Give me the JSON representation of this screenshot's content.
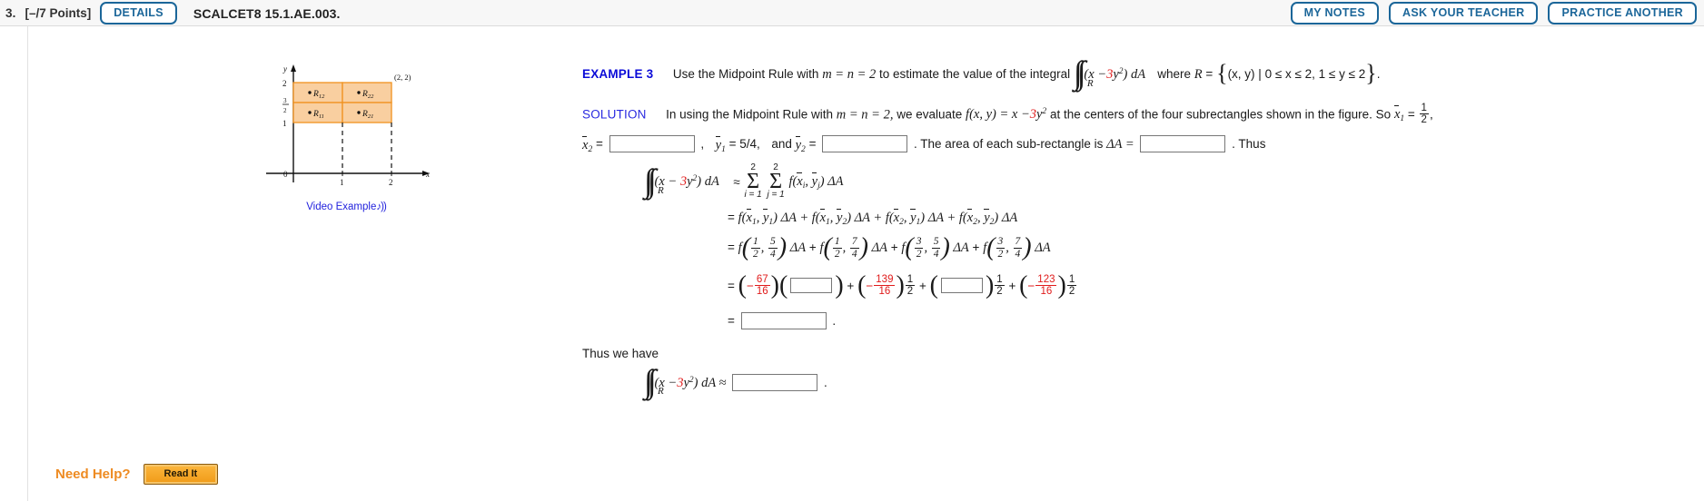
{
  "topbar": {
    "question_number": "3.",
    "points": "[–/7 Points]",
    "details_button": "DETAILS",
    "question_code": "SCALCET8 15.1.AE.003.",
    "my_notes_button": "MY NOTES",
    "ask_teacher_button": "ASK YOUR TEACHER",
    "practice_another_button": "PRACTICE ANOTHER"
  },
  "figure": {
    "axis_y_label": "y",
    "axis_x_label": "x",
    "origin_label": "0",
    "x_ticks": [
      "1",
      "2"
    ],
    "y_ticks": [
      "2",
      "1"
    ],
    "y_frac_tick_num": "3",
    "y_frac_tick_den": "2",
    "corner_label": "(2, 2)",
    "cells": [
      "R12",
      "R22",
      "R11",
      "R21"
    ],
    "cell_labels": [
      {
        "base": "R",
        "sub": "12"
      },
      {
        "base": "R",
        "sub": "22"
      },
      {
        "base": "R",
        "sub": "11"
      },
      {
        "base": "R",
        "sub": "21"
      }
    ],
    "fill_color": "#f9cfa0",
    "stroke_color": "#f0921e",
    "video_example_link": "Video Example"
  },
  "example": {
    "label": "EXAMPLE 3",
    "statement_part1": "Use the Midpoint Rule with",
    "m_eq_n_eq_2": "m = n = 2",
    "statement_part2": "to estimate the value of the integral",
    "integrand_left": "(x −",
    "integrand_coef": "3",
    "integrand_var": "y",
    "integrand_exp": "2",
    "integrand_right": ") dA",
    "where": "where",
    "region_R": "R",
    "eq": "=",
    "region_set": "(x, y) | 0 ≤ x ≤ 2, 1 ≤ y ≤ 2",
    "period": "."
  },
  "solution": {
    "label": "SOLUTION",
    "line1_a": "In using the Midpoint Rule with",
    "line1_mn": "m = n = 2,",
    "line1_b": "we evaluate",
    "line1_fxy": "f(x, y) = x −",
    "line1_coef": "3",
    "line1_var": "y",
    "line1_exp": "2",
    "line1_c": "at the centers of the four subrectangles shown in the figure. So",
    "x1_bar": "x",
    "x1_sub": "1",
    "x1_val_num": "1",
    "x1_val_den": "2",
    "comma": ",",
    "x2_bar": "x",
    "x2_sub": "2",
    "x2_value": "",
    "y1_bar": "y",
    "y1_sub": "1",
    "y1_value_text": "= 5/4,",
    "and": "and",
    "y2_bar": "y",
    "y2_sub": "2",
    "y2_value": "",
    "area_text": ". The area of each sub-rectangle is",
    "delta_A": "ΔA =",
    "delta_A_value": "",
    "thus": ". Thus"
  },
  "equations": {
    "line1": {
      "int_sub": "R",
      "integrand": "(x − 3y2) dA",
      "approx": "≈",
      "sigma1_top": "2",
      "sigma1_bot": "i = 1",
      "sigma2_top": "2",
      "sigma2_bot": "j = 1",
      "term": "f(xi, yj) ΔA"
    },
    "line2": "= f(x1, y1) ΔA + f(x1, y2) ΔA + f(x2, y1) ΔA + f(x2, y2) ΔA",
    "line3_terms": [
      {
        "xn": "1",
        "xd": "2",
        "yn": "5",
        "yd": "4"
      },
      {
        "xn": "1",
        "xd": "2",
        "yn": "7",
        "yd": "4"
      },
      {
        "xn": "3",
        "xd": "2",
        "yn": "5",
        "yd": "4"
      },
      {
        "xn": "3",
        "xd": "2",
        "yn": "7",
        "yd": "4"
      }
    ],
    "line3_suffix": "ΔA",
    "line4": {
      "t1_num": "67",
      "t1_den": "16",
      "t1_box": "",
      "t2_num": "139",
      "t2_den": "16",
      "t2_half_num": "1",
      "t2_half_den": "2",
      "t3_box": "",
      "t3_half_num": "1",
      "t3_half_den": "2",
      "t4_num": "123",
      "t4_den": "16",
      "t4_half_num": "1",
      "t4_half_den": "2"
    },
    "line5_value": "",
    "line5_period": "."
  },
  "conclusion": {
    "text": "Thus we have",
    "int_sub": "R",
    "integrand_left": "(x −",
    "integrand_coef": "3",
    "integrand_var": "y",
    "integrand_exp": "2",
    "integrand_right": ") dA ≈",
    "answer_value": "",
    "period": "."
  },
  "footer": {
    "need_help_label": "Need Help?",
    "read_it_button": "Read It"
  },
  "colors": {
    "accent_blue": "#1b6699",
    "example_blue": "#0b0bd8",
    "math_red": "#e01b1b",
    "orange": "#ee8b22",
    "figure_fill": "#f9cfa0",
    "figure_stroke": "#f0921e"
  }
}
